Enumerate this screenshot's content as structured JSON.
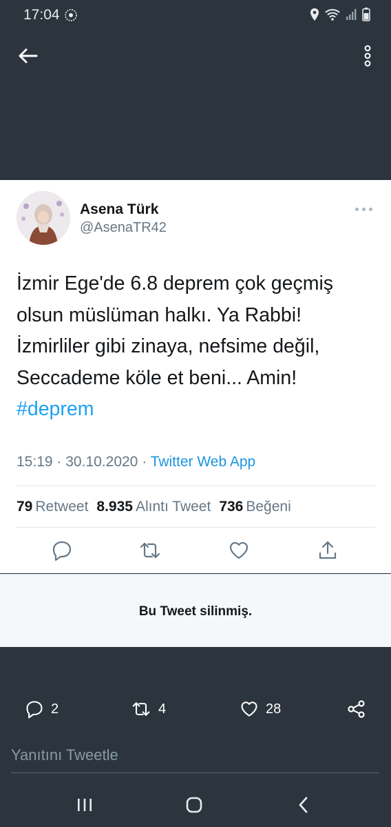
{
  "status_bar": {
    "time": "17:04",
    "icons": [
      "sync-icon",
      "location-icon",
      "wifi-icon",
      "signal-icon",
      "battery-icon"
    ]
  },
  "app_bar": {
    "back_icon": "back-arrow-icon",
    "more_icon": "more-vertical-icon"
  },
  "tweet": {
    "author_name": "Asena Türk",
    "author_handle": "@AsenaTR42",
    "text": "İzmir Ege'de 6.8  deprem çok geçmiş\nolsun müslüman halkı. Ya Rabbi!\nİzmirliler gibi zinaya, nefsime değil,\nSeccademe köle et beni... Amin!",
    "hashtag": "#deprem",
    "time": "15:19",
    "separator": "·",
    "date": "30.10.2020",
    "source": "Twitter Web App",
    "stats": {
      "retweets_count": "79",
      "retweets_label": "Retweet",
      "quotes_count": "8.935",
      "quotes_label": "Alıntı Tweet",
      "likes_count": "736",
      "likes_label": "Beğeni"
    },
    "actions": [
      "reply-icon",
      "retweet-icon",
      "like-icon",
      "share-icon"
    ]
  },
  "deleted_notice": "Bu Tweet silinmiş.",
  "bottom_bar": {
    "replies": "2",
    "retweets": "4",
    "likes": "28"
  },
  "reply_placeholder": "Yanıtını Tweetle",
  "colors": {
    "background": "#2c353d",
    "accent": "#1da1f2",
    "secondary_text": "#657786"
  }
}
